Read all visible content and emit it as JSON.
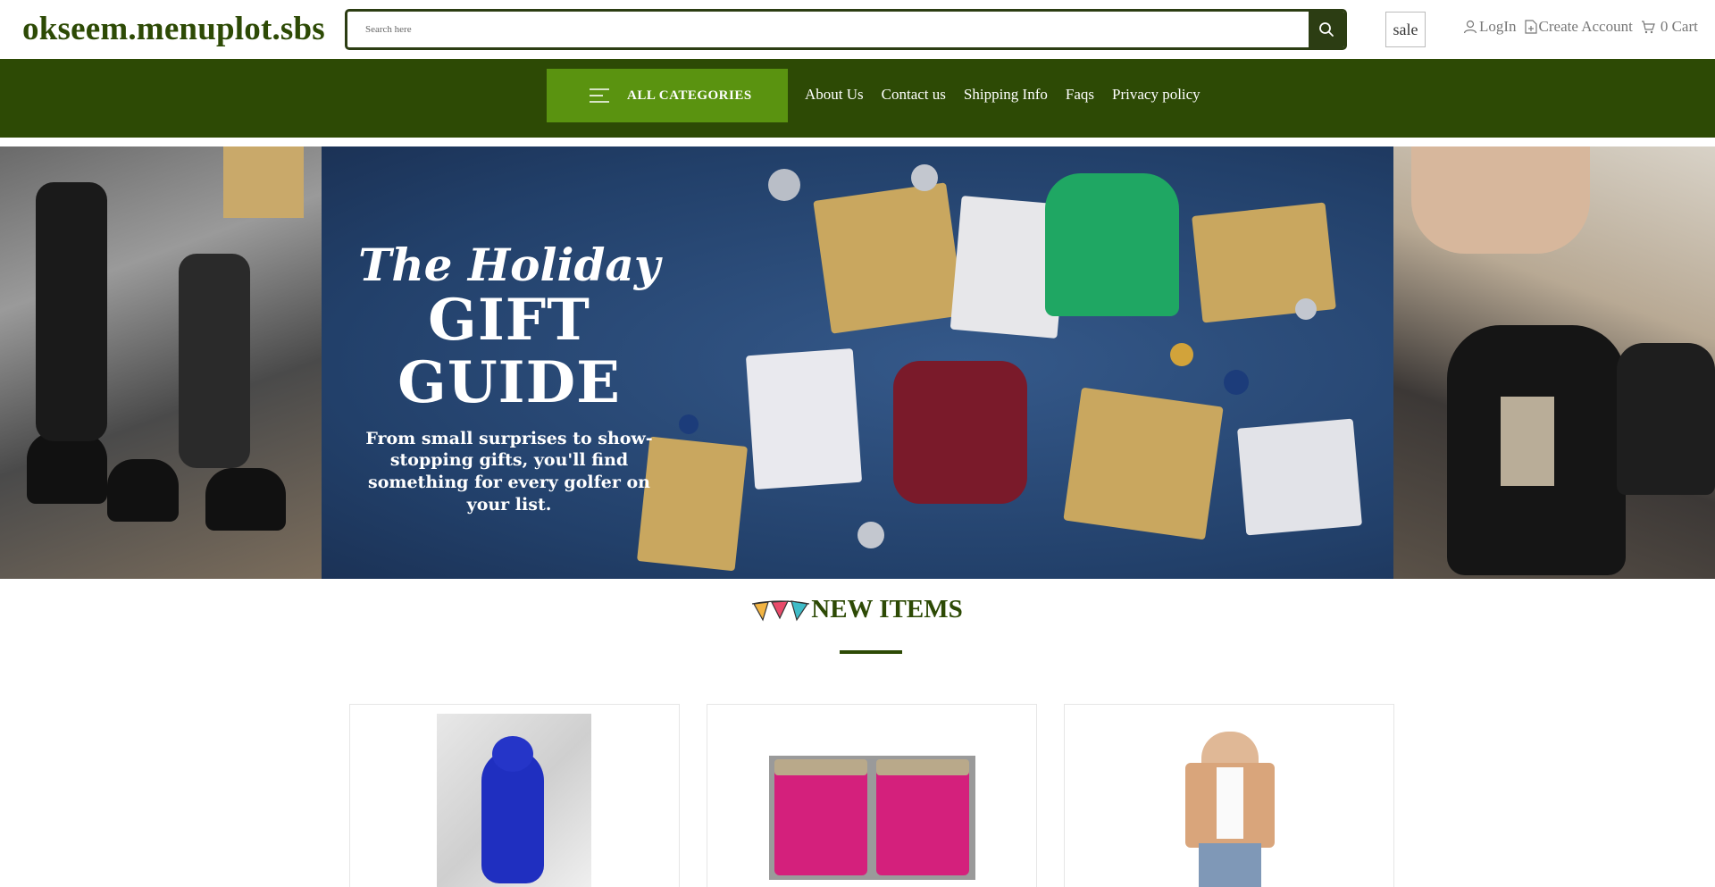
{
  "header": {
    "logo": "okseem.menuplot.sbs",
    "search_placeholder": "Search here",
    "sale_label": "sale",
    "login_label": "LogIn",
    "create_account_label": "Create Account",
    "cart_label": "0 Cart"
  },
  "nav": {
    "categories_label": "ALL CATEGORIES",
    "links": [
      "About Us",
      "Contact us",
      "Shipping Info",
      "Faqs",
      "Privacy policy"
    ]
  },
  "banner": {
    "title_script": "The Holiday",
    "title_main": "GIFT GUIDE",
    "subtitle": "From small surprises to show-stopping gifts, you'll find something for every golfer on your list."
  },
  "new_items": {
    "title": "NEW ITEMS"
  },
  "colors": {
    "brand_dark_green": "#2d4a05",
    "accent_green": "#5a9310",
    "search_border": "#2c3d13"
  }
}
